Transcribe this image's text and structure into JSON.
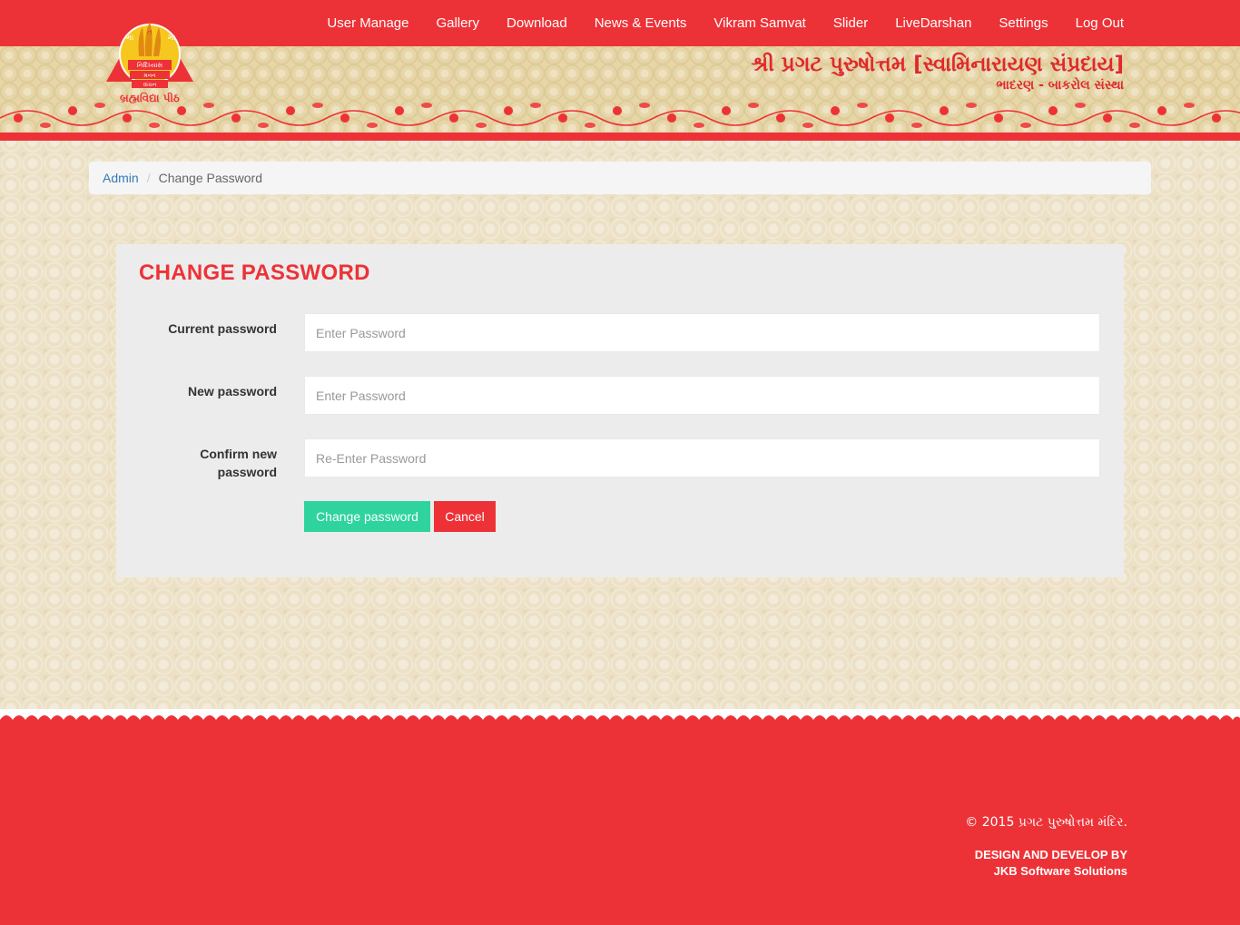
{
  "nav": {
    "items": [
      {
        "label": "User Manage"
      },
      {
        "label": "Gallery"
      },
      {
        "label": "Download"
      },
      {
        "label": "News & Events"
      },
      {
        "label": "Vikram Samvat"
      },
      {
        "label": "Slider"
      },
      {
        "label": "LiveDarshan"
      },
      {
        "label": "Settings"
      },
      {
        "label": "Log Out"
      }
    ]
  },
  "logo": {
    "top_letters": [
      "મા",
      "ત",
      "મા"
    ],
    "center_lines": [
      "નિદિધ્યાસ",
      "મનન",
      "વાંચન"
    ],
    "bottom_text": "બ્રહ્મવિદ્યા પીઠ",
    "colors": {
      "triangle": "#ed3237",
      "circle": "#f6c71e"
    }
  },
  "banner": {
    "title": "શ્રી પ્રગટ પુરુષોત્તમ [સ્વામિનારાયણ સંપ્રદાય]",
    "subtitle": "ભાદરણ - બાકરોલ સંસ્થા"
  },
  "breadcrumb": {
    "link": "Admin",
    "separator": "/",
    "current": "Change Password"
  },
  "form": {
    "title": "CHANGE PASSWORD",
    "current_label": "Current password",
    "current_placeholder": "Enter Password",
    "new_label": "New password",
    "new_placeholder": "Enter Password",
    "confirm_label": "Confirm new password",
    "confirm_placeholder": "Re-Enter Password",
    "submit_label": "Change password",
    "cancel_label": "Cancel"
  },
  "footer": {
    "copyright": "© 2015 પ્રગટ પુરુષોત્તમ મંદિર.",
    "design_by": "DESIGN AND DEVELOP BY",
    "company": "JKB Software Solutions"
  },
  "colors": {
    "brand_red": "#ed3237",
    "button_green": "#2ed39e",
    "link_blue": "#337ab7",
    "banner_bg": "#e6d6a8"
  }
}
